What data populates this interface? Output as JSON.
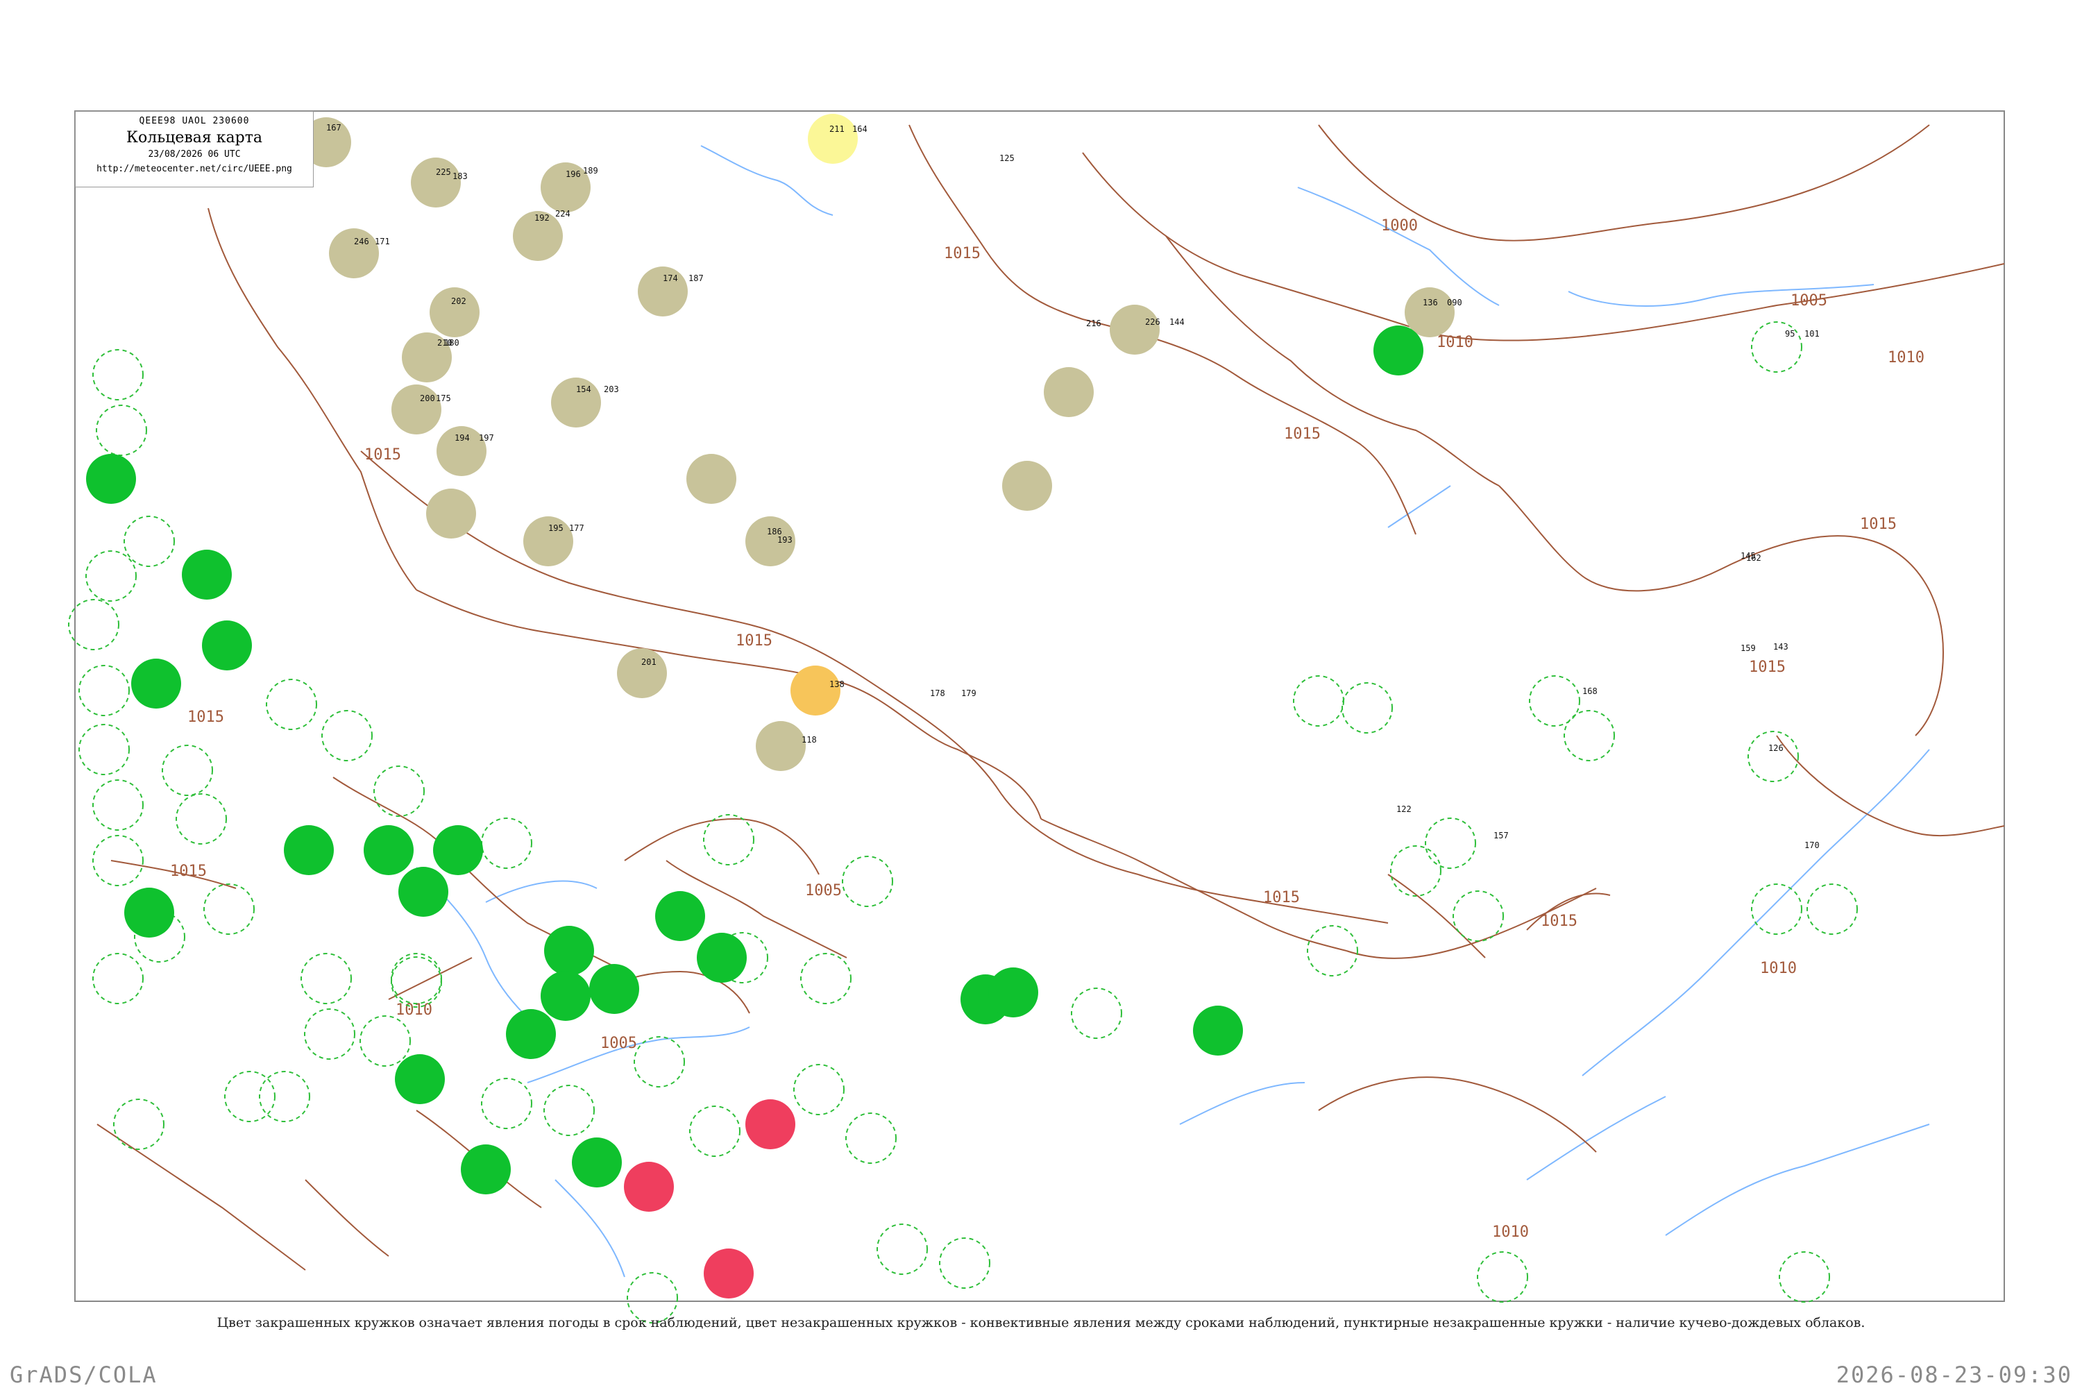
{
  "header": {
    "code": "QEEE98  UAOL  230600",
    "title": "Кольцевая карта",
    "date": "23/08/2026 06 UTC",
    "url": "http://meteocenter.net/circ/UEEE.png"
  },
  "caption": "Цвет закрашенных кружков означает явления погоды в срок наблюдений, цвет незакрашенных кружков - конвективные явления между сроками наблюдений, пунктирные незакрашенные кружки - наличие кучево-дождевых облаков.",
  "footer": {
    "left": "GrADS/COLA",
    "right": "2026-08-23-09:30"
  },
  "colors": {
    "fog": "#c8c39a",
    "rain": "#0fc12e",
    "thunder": "#ef3e5e",
    "dust": "#f7c55a",
    "haze": "#fbf797",
    "isobar": "#a25a3c",
    "river": "#7fb8ff",
    "cb_dash": "#2fbf3a"
  },
  "isobar_labels": [
    "1000",
    "1005",
    "1010",
    "1015"
  ],
  "stations": [
    {
      "n": "167"
    },
    {
      "n": "183"
    },
    {
      "n": "196"
    },
    {
      "n": "211"
    },
    {
      "n": "164"
    },
    {
      "n": "125"
    },
    {
      "n": "225"
    },
    {
      "n": "189"
    },
    {
      "n": "192"
    },
    {
      "n": "224"
    },
    {
      "n": "246"
    },
    {
      "n": "171"
    },
    {
      "n": "174"
    },
    {
      "n": "187"
    },
    {
      "n": "202"
    },
    {
      "n": "210"
    },
    {
      "n": "180"
    },
    {
      "n": "200"
    },
    {
      "n": "175"
    },
    {
      "n": "154"
    },
    {
      "n": "203"
    },
    {
      "n": "194"
    },
    {
      "n": "197"
    },
    {
      "n": "186"
    },
    {
      "n": "193"
    },
    {
      "n": "195"
    },
    {
      "n": "177"
    },
    {
      "n": "216"
    },
    {
      "n": "226"
    },
    {
      "n": "144"
    },
    {
      "n": "136"
    },
    {
      "n": "090"
    },
    {
      "n": "101"
    },
    {
      "n": "95"
    },
    {
      "n": "178"
    },
    {
      "n": "179"
    },
    {
      "n": "201"
    },
    {
      "n": "138"
    },
    {
      "n": "118"
    },
    {
      "n": "168"
    },
    {
      "n": "170"
    },
    {
      "n": "122"
    },
    {
      "n": "126"
    },
    {
      "n": "162"
    },
    {
      "n": "145"
    },
    {
      "n": "143"
    },
    {
      "n": "159"
    },
    {
      "n": "157"
    }
  ]
}
